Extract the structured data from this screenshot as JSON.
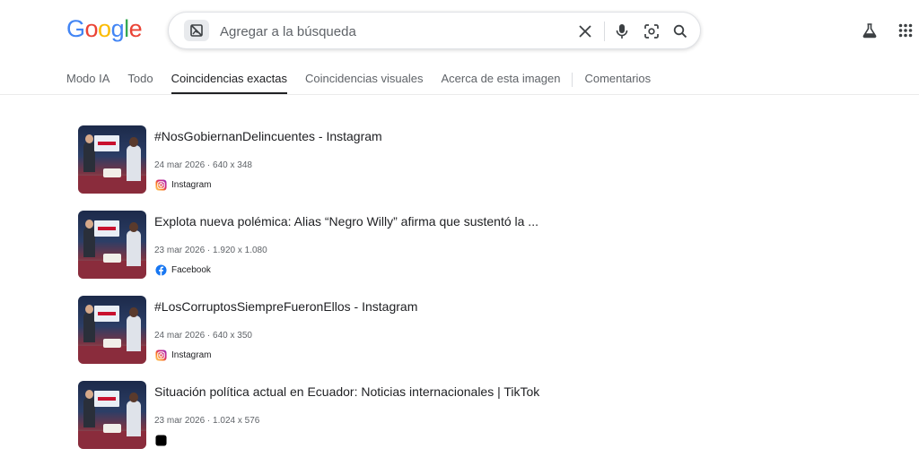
{
  "logo": {
    "letters": [
      "G",
      "o",
      "o",
      "g",
      "l",
      "e"
    ],
    "colors": [
      "#4285f4",
      "#ea4335",
      "#fbbc05",
      "#4285f4",
      "#34a853",
      "#ea4335"
    ]
  },
  "search": {
    "placeholder": "Agregar a la búsqueda",
    "value": ""
  },
  "icons": {
    "image_chip": "image-off-icon",
    "clear": "close-icon",
    "voice": "microphone-icon",
    "lens": "lens-icon",
    "search": "search-icon",
    "labs": "flask-icon",
    "apps": "apps-grid-icon"
  },
  "tabs": [
    {
      "label": "Modo IA"
    },
    {
      "label": "Todo"
    },
    {
      "label": "Coincidencias exactas",
      "active": true
    },
    {
      "label": "Coincidencias visuales"
    },
    {
      "label": "Acerca de esta imagen"
    },
    {
      "label": "Comentarios"
    }
  ],
  "results": [
    {
      "title": "#NosGobiernanDelincuentes - Instagram",
      "date": "24 mar 2026",
      "size": "640 x 348",
      "source": "Instagram",
      "source_icon": "instagram-icon"
    },
    {
      "title": "Explota nueva polémica: Alias “Negro Willy” afirma que sustentó la ...",
      "date": "23 mar 2026",
      "size": "1.920 x 1.080",
      "source": "Facebook",
      "source_icon": "facebook-icon"
    },
    {
      "title": "#LosCorruptosSiempreFueronEllos - Instagram",
      "date": "24 mar 2026",
      "size": "640 x 350",
      "source": "Instagram",
      "source_icon": "instagram-icon"
    },
    {
      "title": "Situación política actual en Ecuador: Noticias internacionales | TikTok",
      "date": "23 mar 2026",
      "size": "1.024 x 576",
      "source": "",
      "source_icon": "tiktok-icon"
    }
  ],
  "meta_separator": " · "
}
